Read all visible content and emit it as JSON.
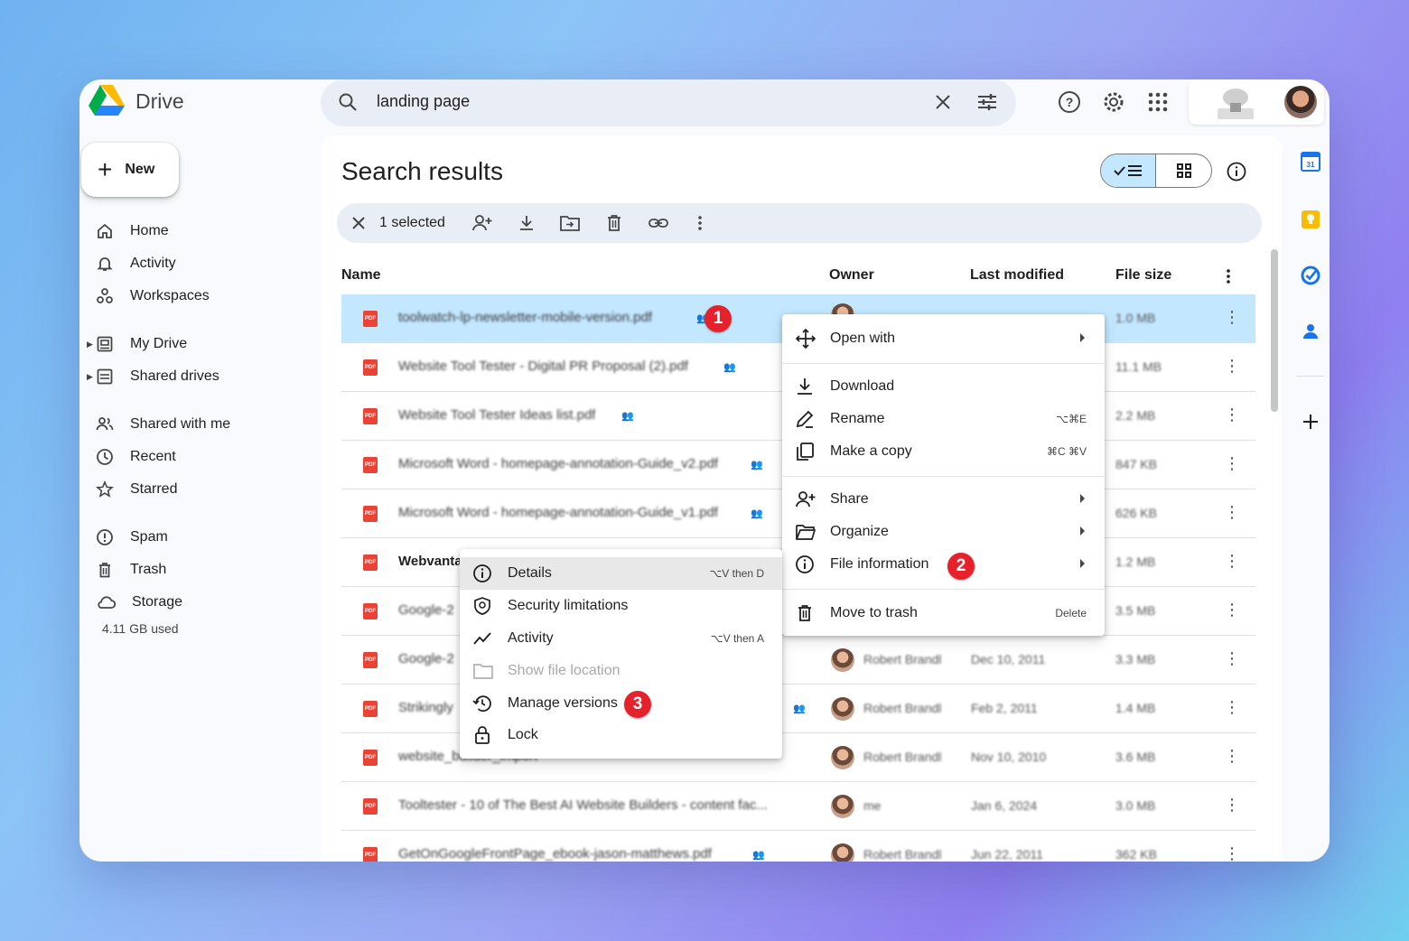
{
  "app": {
    "name": "Drive"
  },
  "search": {
    "query": "landing page"
  },
  "sidebar": {
    "new_label": "New",
    "items": [
      {
        "label": "Home",
        "icon": "home-icon"
      },
      {
        "label": "Activity",
        "icon": "bell-icon"
      },
      {
        "label": "Workspaces",
        "icon": "workspaces-icon"
      },
      {
        "label": "My Drive",
        "icon": "drive-icon"
      },
      {
        "label": "Shared drives",
        "icon": "shared-drives-icon"
      },
      {
        "label": "Shared with me",
        "icon": "people-icon"
      },
      {
        "label": "Recent",
        "icon": "clock-icon"
      },
      {
        "label": "Starred",
        "icon": "star-icon"
      },
      {
        "label": "Spam",
        "icon": "spam-icon"
      },
      {
        "label": "Trash",
        "icon": "trash-icon"
      },
      {
        "label": "Storage",
        "icon": "cloud-icon"
      }
    ],
    "storage_used": "4.11 GB used"
  },
  "main": {
    "title": "Search results",
    "selection": {
      "count_label": "1 selected"
    },
    "columns": {
      "name": "Name",
      "owner": "Owner",
      "modified": "Last modified",
      "size": "File size"
    },
    "rows": [
      {
        "name": "toolwatch-lp-newsletter-mobile-version.pdf",
        "owner": "",
        "modified": "",
        "size": "1.0 MB"
      },
      {
        "name": "Website Tool Tester - Digital PR Proposal (2).pdf",
        "owner": "",
        "modified": "",
        "size": "11.1 MB"
      },
      {
        "name": "Website Tool Tester Ideas list.pdf",
        "owner": "",
        "modified": "",
        "size": "2.2 MB"
      },
      {
        "name": "Microsoft Word - homepage-annotation-Guide_v2.pdf",
        "owner": "",
        "modified": "",
        "size": "847 KB"
      },
      {
        "name": "Microsoft Word - homepage-annotation-Guide_v1.pdf",
        "owner": "",
        "modified": "",
        "size": "626 KB"
      },
      {
        "name": "Webvanta",
        "owner": "",
        "modified": "",
        "size": "1.2 MB"
      },
      {
        "name": "Google-2",
        "owner": "",
        "modified": "",
        "size": "3.5 MB"
      },
      {
        "name": "Google-2",
        "owner": "Robert Brandl",
        "modified": "Dec 10, 2011",
        "size": "3.3 MB"
      },
      {
        "name": "Strikingly",
        "owner": "Robert Brandl",
        "modified": "Feb 2, 2011",
        "size": "1.4 MB"
      },
      {
        "name": "website_builder_import",
        "owner": "Robert Brandl",
        "modified": "Nov 10, 2010",
        "size": "3.6 MB"
      },
      {
        "name": "Tooltester - 10 of The Best AI Website Builders - content fac...",
        "owner": "me",
        "modified": "Jan 6, 2024",
        "size": "3.0 MB"
      },
      {
        "name": "GetOnGoogleFrontPage_ebook-jason-matthews.pdf",
        "owner": "Robert Brandl",
        "modified": "Jun 22, 2011",
        "size": "362 KB"
      }
    ]
  },
  "context_menu": {
    "open_with": "Open with",
    "download": "Download",
    "rename": "Rename",
    "rename_shortcut": "⌥⌘E",
    "make_copy": "Make a copy",
    "make_copy_shortcut": "⌘C ⌘V",
    "share": "Share",
    "organize": "Organize",
    "file_information": "File information",
    "move_to_trash": "Move to trash",
    "trash_shortcut": "Delete"
  },
  "submenu": {
    "details": "Details",
    "details_shortcut": "⌥V then D",
    "security": "Security limitations",
    "activity": "Activity",
    "activity_shortcut": "⌥V then A",
    "show_location": "Show file location",
    "manage_versions": "Manage versions",
    "lock": "Lock"
  },
  "badges": [
    "1",
    "2",
    "3"
  ],
  "colors": {
    "accent": "#c2e7ff",
    "badge": "#e5222c",
    "pdf": "#ea4335"
  }
}
